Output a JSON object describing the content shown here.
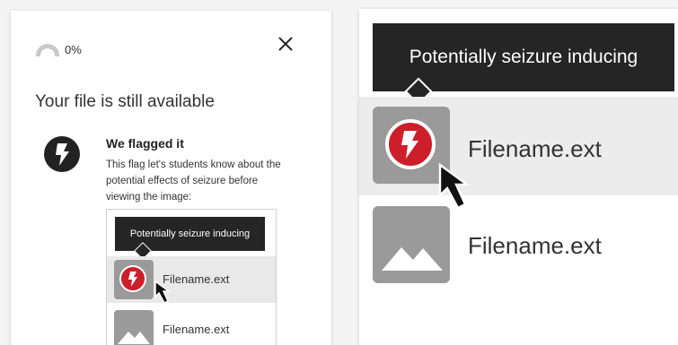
{
  "modal": {
    "progress_text": "0%",
    "progress_value": 0,
    "heading": "Your file is still available",
    "flag_title": "We flagged it",
    "flag_description": "This flag let's students know about the potential effects of seizure before viewing the image:"
  },
  "preview": {
    "tooltip": "Potentially seizure inducing",
    "files": [
      {
        "name": "Filename.ext",
        "flagged": true,
        "icon": "lightning-icon"
      },
      {
        "name": "Filename.ext",
        "flagged": false,
        "icon": "image-placeholder-icon"
      }
    ]
  },
  "zoom": {
    "tooltip": "Potentially seizure inducing",
    "files": [
      {
        "name": "Filename.ext",
        "flagged": true,
        "icon": "lightning-icon"
      },
      {
        "name": "Filename.ext",
        "flagged": false,
        "icon": "image-placeholder-icon"
      }
    ]
  },
  "colors": {
    "flag_red": "#cc1f2b",
    "tooltip_bg": "#252525",
    "thumb_gray": "#9a9a9a",
    "highlight_row": "#e9e9e9"
  }
}
